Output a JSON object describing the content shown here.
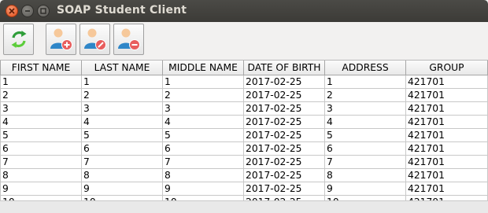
{
  "window": {
    "title": "SOAP Student Client",
    "controls": [
      "close-icon",
      "minimize-icon",
      "maximize-icon"
    ]
  },
  "toolbar": {
    "buttons": [
      {
        "name": "refresh-button",
        "icon": "refresh-icon"
      },
      {
        "name": "add-student-button",
        "icon": "user-add-icon"
      },
      {
        "name": "edit-student-button",
        "icon": "user-edit-icon"
      },
      {
        "name": "remove-student-button",
        "icon": "user-remove-icon"
      }
    ]
  },
  "table": {
    "columns": [
      "FIRST NAME",
      "LAST NAME",
      "MIDDLE NAME",
      "DATE OF BIRTH",
      "ADDRESS",
      "GROUP"
    ],
    "rows": [
      [
        "1",
        "1",
        "1",
        "2017-02-25",
        "1",
        "421701"
      ],
      [
        "2",
        "2",
        "2",
        "2017-02-25",
        "2",
        "421701"
      ],
      [
        "3",
        "3",
        "3",
        "2017-02-25",
        "3",
        "421701"
      ],
      [
        "4",
        "4",
        "4",
        "2017-02-25",
        "4",
        "421701"
      ],
      [
        "5",
        "5",
        "5",
        "2017-02-25",
        "5",
        "421701"
      ],
      [
        "6",
        "6",
        "6",
        "2017-02-25",
        "6",
        "421701"
      ],
      [
        "7",
        "7",
        "7",
        "2017-02-25",
        "7",
        "421701"
      ],
      [
        "8",
        "8",
        "8",
        "2017-02-25",
        "8",
        "421701"
      ],
      [
        "9",
        "9",
        "9",
        "2017-02-25",
        "9",
        "421701"
      ],
      [
        "10",
        "10",
        "10",
        "2017-02-25",
        "10",
        "421701"
      ]
    ]
  },
  "colors": {
    "titlebar": "#3c3b37",
    "close": "#df4b16",
    "refresh": "#3cb043",
    "user_body": "#2f86c8",
    "add_badge": "#e85d5d",
    "edit_badge": "#e85d5d",
    "remove_badge": "#e85d5d"
  }
}
